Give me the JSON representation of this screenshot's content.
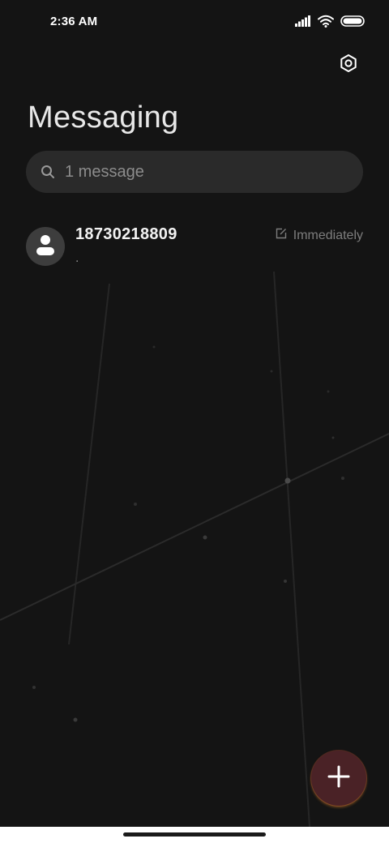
{
  "status_bar": {
    "time": "2:36 AM",
    "icons": [
      "signal-icon",
      "wifi-icon",
      "battery-icon"
    ]
  },
  "header": {
    "title": "Messaging",
    "settings_icon": "settings-hexagon-icon"
  },
  "search": {
    "placeholder": "1 message",
    "icon": "search-icon"
  },
  "conversations": [
    {
      "name": "18730218809",
      "preview": ".",
      "time": "Immediately",
      "status_icon": "draft-edit-icon",
      "avatar_icon": "person-icon"
    }
  ],
  "fab": {
    "icon": "plus-icon",
    "color": "#4a2226"
  },
  "colors": {
    "background": "#141414",
    "search_bg": "#2a2a2a",
    "avatar_bg": "#3d3d3d"
  }
}
